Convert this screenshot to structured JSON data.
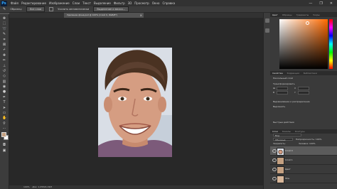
{
  "app": {
    "logo": "Ps"
  },
  "menu": [
    "Файл",
    "Редактирование",
    "Изображение",
    "Слои",
    "Текст",
    "Выделение",
    "Фильтр",
    "3D",
    "Просмотр",
    "Окно",
    "Справка"
  ],
  "window_controls": {
    "minimize": "—",
    "maximize": "❐",
    "close": "✕"
  },
  "options": {
    "sample_label": "Образец:",
    "sample_value": "Все слои",
    "enhance_label": "Усилить автоматически",
    "refine_button": "Выделение и маска..."
  },
  "document": {
    "tab_title": "Удаление фона.psd @ 100% (Слой 0, RGB/8*)",
    "close_glyph": "×"
  },
  "status": {
    "zoom": "100%",
    "doc_info": "Док: 1,05M/4,19M"
  },
  "panels": {
    "color_tabs": [
      "Цвет",
      "Образцы",
      "Градиенты",
      "Узоры"
    ],
    "props_tabs": [
      "Свойства",
      "Коррекция",
      "Библиотеки"
    ],
    "props_title": "Пиксельный слой",
    "transform_label": "Трансформировать",
    "w_label": "Ш",
    "h_label": "В",
    "x_label": "X",
    "y_label": "Y",
    "align_label": "Выравнивание и распределение",
    "align_sub": "Выровнять",
    "quick_label": "Быстрые действия",
    "layers_tabs": [
      "Слои",
      "Каналы",
      "Контуры"
    ],
    "layers_kind": "Вид",
    "blend_mode": "Обычные",
    "opacity_label": "Непрозрачность: 100%",
    "lock_label": "Закрепить:",
    "fill_label": "Заливка: 100%"
  },
  "layers": [
    {
      "name": "Слой 0",
      "selected": true
    },
    {
      "name": "Слой 1",
      "selected": false
    },
    {
      "name": "Цвет",
      "selected": false
    },
    {
      "name": "Фон",
      "selected": false
    }
  ],
  "colors": {
    "foreground": "#c4a081",
    "background": "#ffffff",
    "accent": "#31a8ff"
  }
}
